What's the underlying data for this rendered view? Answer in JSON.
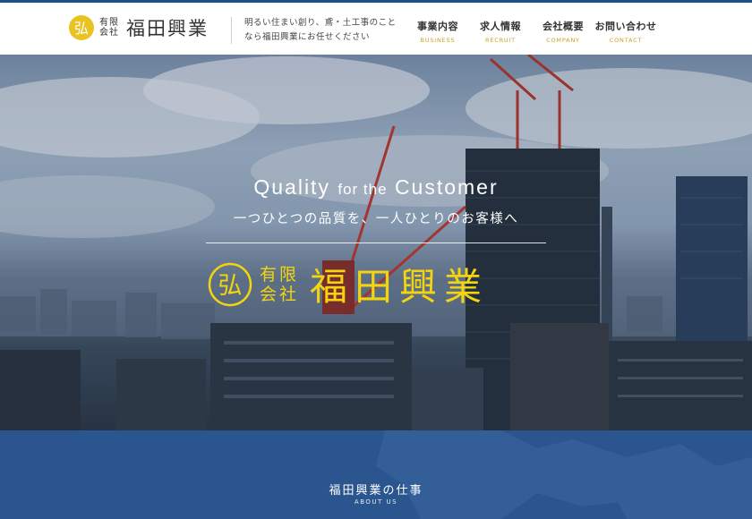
{
  "header": {
    "logo_mark": "弘",
    "logo_small_1": "有限",
    "logo_small_2": "会社",
    "logo_name": "福田興業",
    "tagline_1": "明るい住まい創り、鳶・土工事のこと",
    "tagline_2": "なら福田興業にお任せください",
    "nav": [
      {
        "jp": "事業内容",
        "en": "BUSINESS"
      },
      {
        "jp": "求人情報",
        "en": "RECRUIT"
      },
      {
        "jp": "会社概要",
        "en": "COMPANY"
      },
      {
        "jp": "お問い合わせ",
        "en": "CONTACT"
      }
    ]
  },
  "hero": {
    "title_1": "Quality",
    "title_2": "for the",
    "title_3": "Customer",
    "subtitle": "一つひとつの品質を、一人ひとりのお客様へ",
    "logo_mark": "弘",
    "logo_small_1": "有限",
    "logo_small_2": "会社",
    "logo_name": "福田興業"
  },
  "about": {
    "title": "福田興業の仕事",
    "subtitle": "ABOUT US"
  },
  "colors": {
    "brand_blue": "#1e4f8c",
    "accent_gold": "#c9a227",
    "logo_yellow": "#f2d40f",
    "band_blue": "#2b558f"
  }
}
